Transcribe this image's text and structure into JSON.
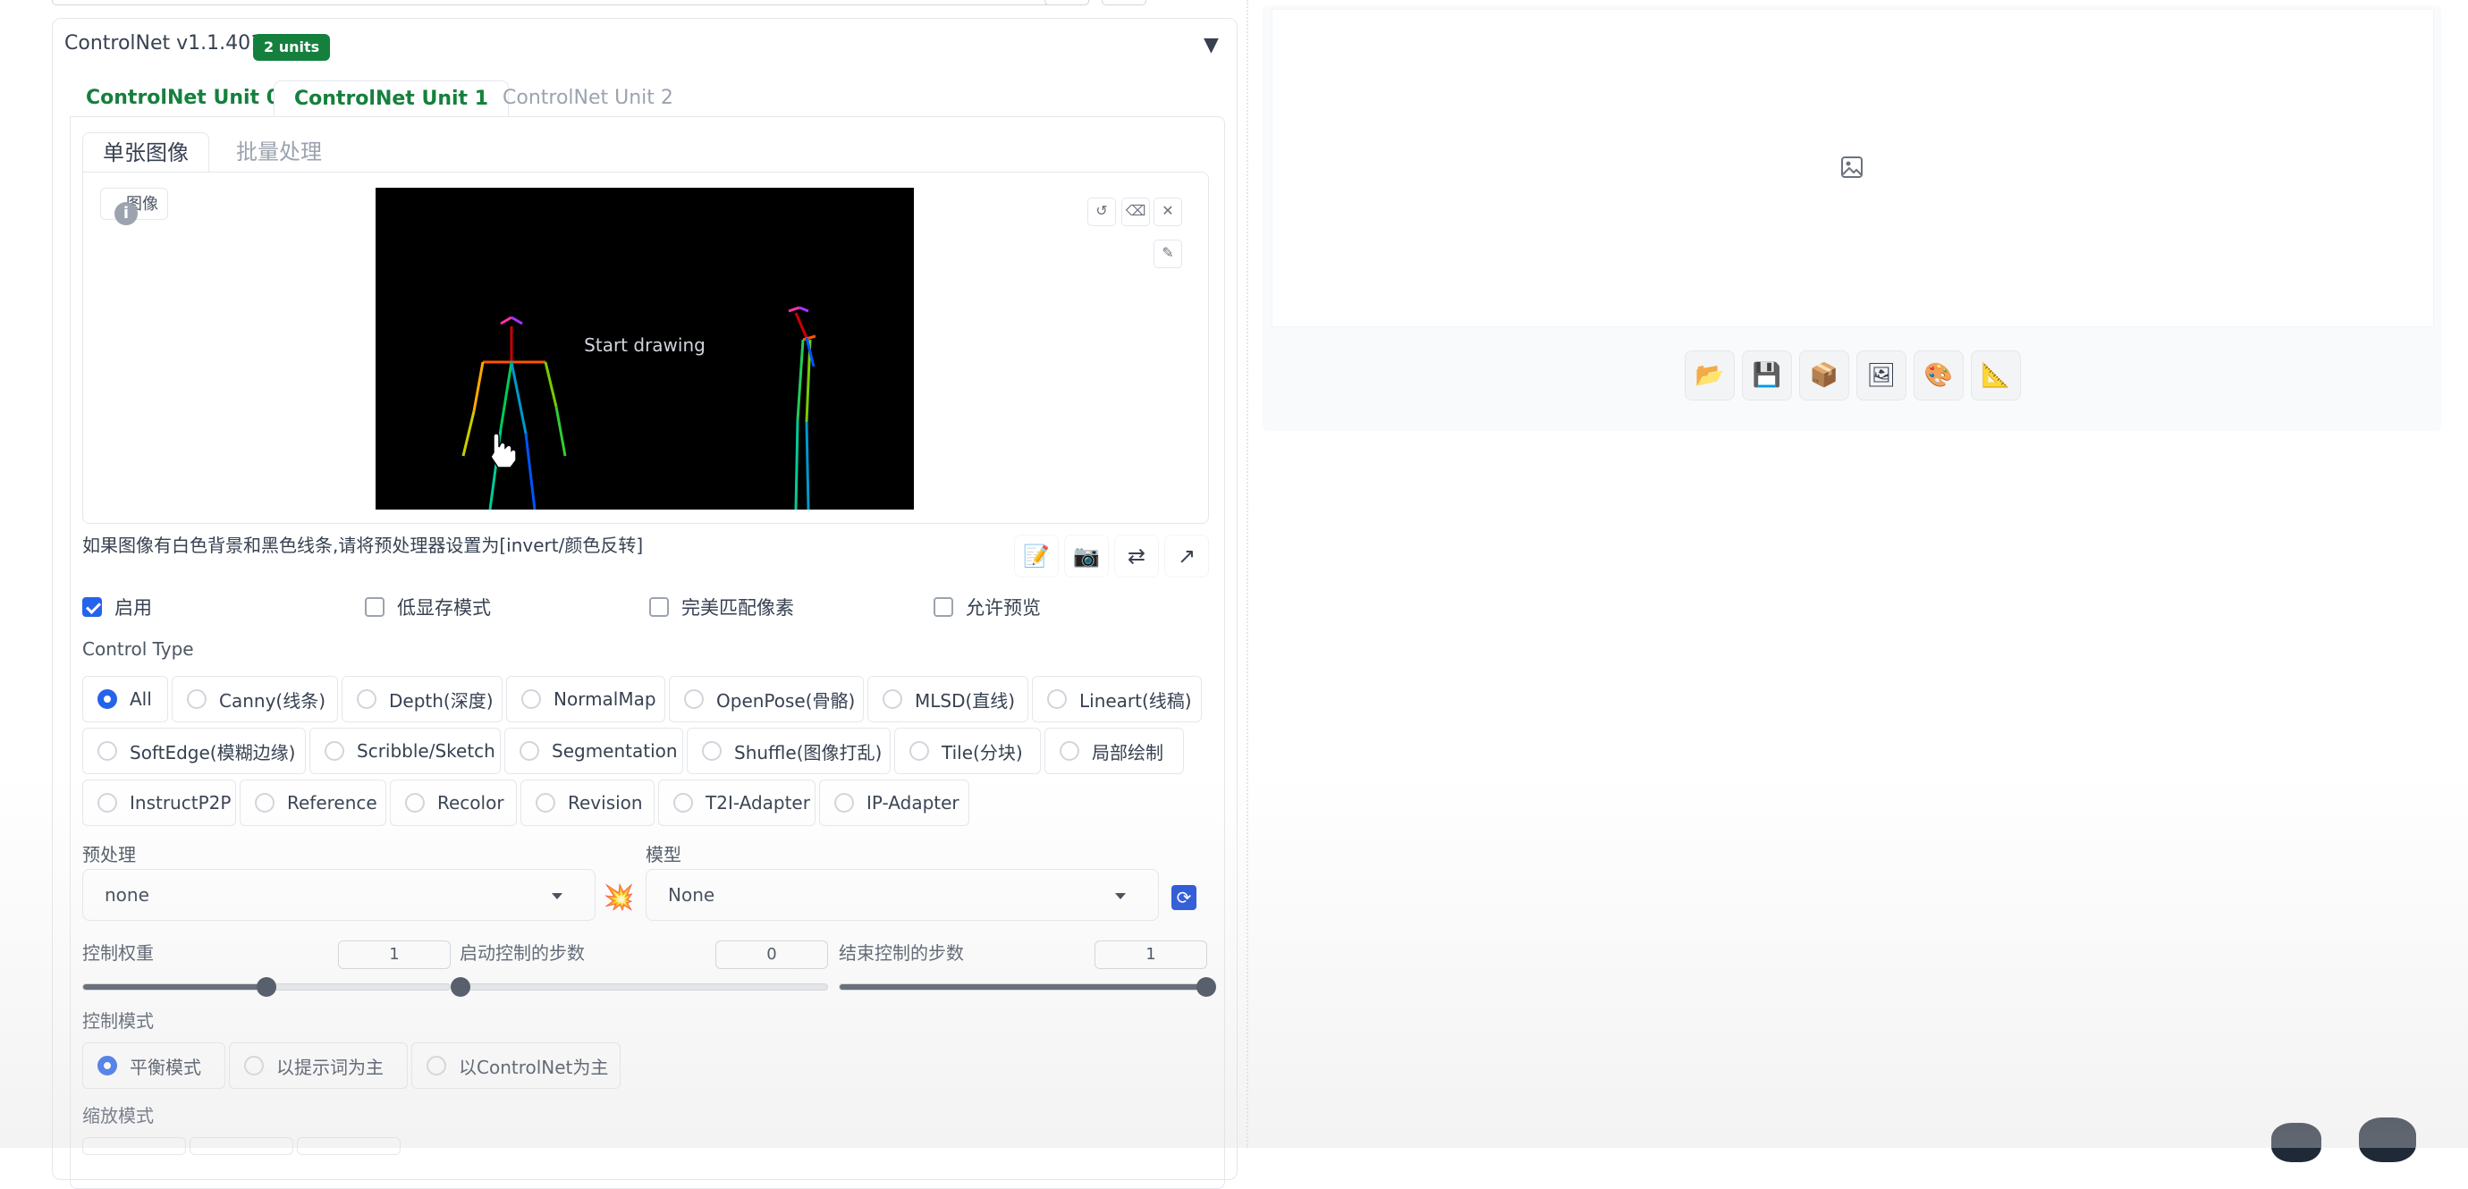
{
  "header": {
    "title": "ControlNet v1.1.401",
    "badge": "2 units",
    "collapse_icon": "triangle-down-icon"
  },
  "unit_tabs": [
    {
      "label": "ControlNet Unit 0"
    },
    {
      "label": "ControlNet Unit 1"
    },
    {
      "label": "ControlNet Unit 2"
    }
  ],
  "sub_tabs": [
    {
      "label": "单张图像"
    },
    {
      "label": "批量处理"
    }
  ],
  "image_panel": {
    "label": "图像",
    "canvas_text": "Start drawing"
  },
  "hint": "如果图像有白色背景和黑色线条,请将预处理器设置为[invert/颜色反转]",
  "checkboxes": [
    {
      "label": "启用",
      "checked": true
    },
    {
      "label": "低显存模式",
      "checked": false
    },
    {
      "label": "完美匹配像素",
      "checked": false
    },
    {
      "label": "允许预览",
      "checked": false
    }
  ],
  "control_type": {
    "label": "Control Type",
    "options": [
      "All",
      "Canny(线条)",
      "Depth(深度)",
      "NormalMap",
      "OpenPose(骨骼)",
      "MLSD(直线)",
      "Lineart(线稿)",
      "SoftEdge(模糊边缘)",
      "Scribble/Sketch",
      "Segmentation",
      "Shuffle(图像打乱)",
      "Tile(分块)",
      "局部绘制",
      "InstructP2P",
      "Reference",
      "Recolor",
      "Revision",
      "T2I-Adapter",
      "IP-Adapter"
    ],
    "selected": "All"
  },
  "preprocessor": {
    "label": "预处理",
    "value": "none"
  },
  "model": {
    "label": "模型",
    "value": "None"
  },
  "sliders": [
    {
      "label": "控制权重",
      "value": "1",
      "fraction": 0.5
    },
    {
      "label": "启动控制的步数",
      "value": "0",
      "fraction": 0.0
    },
    {
      "label": "结束控制的步数",
      "value": "1",
      "fraction": 1.0
    }
  ],
  "control_mode": {
    "label": "控制模式",
    "options": [
      "平衡模式",
      "以提示词为主",
      "以ControlNet为主"
    ],
    "selected": "平衡模式"
  },
  "resize_mode": {
    "label": "缩放模式"
  },
  "colors": {
    "accent": "#2563eb",
    "tab_green": "#15803d",
    "badge": "#15803d"
  }
}
